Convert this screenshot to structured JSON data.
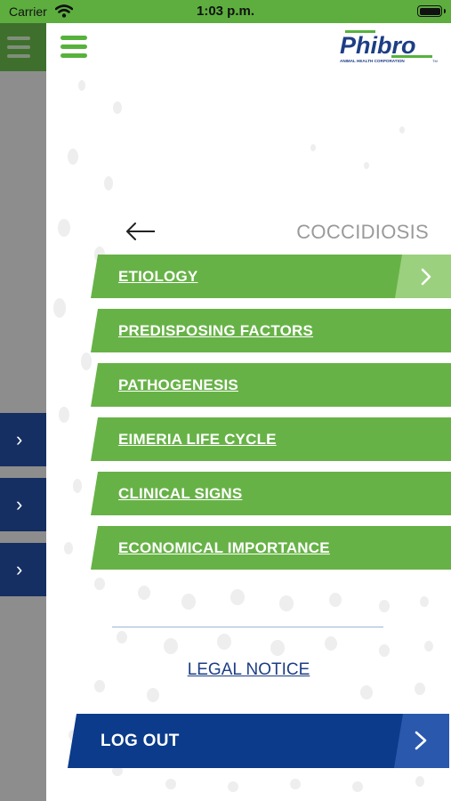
{
  "status_bar": {
    "carrier": "Carrier",
    "time": "1:03 p.m."
  },
  "logo": {
    "brand": "Phibro",
    "tagline": "ANIMAL HEALTH CORPORATION",
    "tm": "TM",
    "colors": {
      "blue": "#1d3e86",
      "green": "#56b23c"
    }
  },
  "page": {
    "title": "COCCIDIOSIS"
  },
  "menu_items": [
    {
      "label": "ETIOLOGY",
      "selected": true
    },
    {
      "label": "PREDISPOSING FACTORS"
    },
    {
      "label": "PATHOGENESIS"
    },
    {
      "label": "EIMERIA LIFE CYCLE"
    },
    {
      "label": "CLINICAL SIGNS"
    },
    {
      "label": "ECONOMICAL IMPORTANCE"
    }
  ],
  "legal_notice": "LEGAL NOTICE",
  "logout": "LOG OUT",
  "icons": {
    "menu": "hamburger-icon",
    "back": "back-arrow-icon",
    "chevron": "chevron-right-icon",
    "wifi": "wifi-icon",
    "battery": "battery-icon"
  },
  "colors": {
    "green": "#67b247",
    "light_green": "#9bd07f",
    "navy": "#0b3b8a",
    "blue": "#2a58ad",
    "status_green": "#5dae3f"
  }
}
